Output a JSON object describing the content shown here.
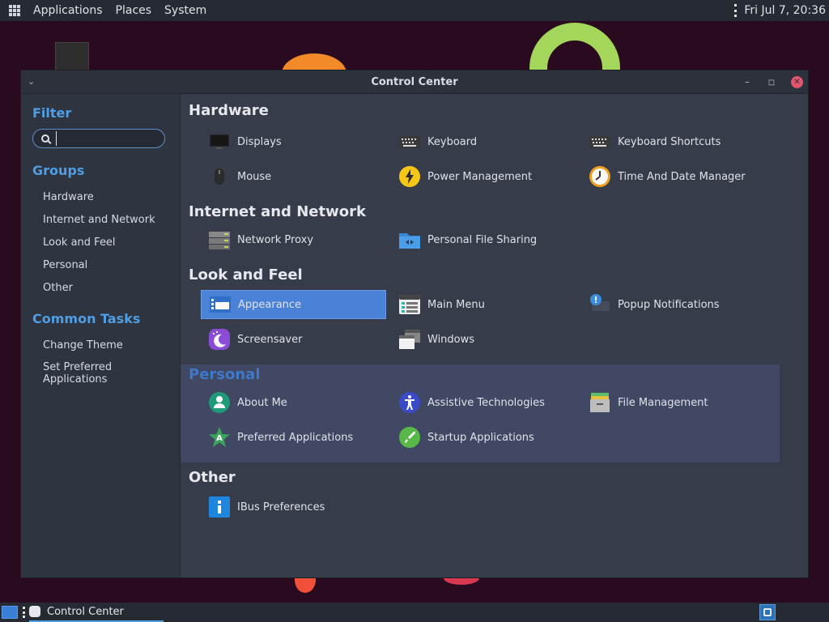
{
  "top_panel": {
    "menus": [
      "Applications",
      "Places",
      "System"
    ],
    "clock": "Fri Jul  7, 20:36"
  },
  "window": {
    "title": "Control Center"
  },
  "sidebar": {
    "filter_heading": "Filter",
    "search_value": "",
    "groups_heading": "Groups",
    "groups": [
      "Hardware",
      "Internet and Network",
      "Look and Feel",
      "Personal",
      "Other"
    ],
    "tasks_heading": "Common Tasks",
    "tasks": [
      "Change Theme",
      "Set Preferred Applications"
    ]
  },
  "sections": [
    {
      "title": "Hardware",
      "items": [
        "Displays",
        "Keyboard",
        "Keyboard Shortcuts",
        "Mouse",
        "Power Management",
        "Time And Date Manager"
      ]
    },
    {
      "title": "Internet and Network",
      "items": [
        "Network Proxy",
        "Personal File Sharing"
      ]
    },
    {
      "title": "Look and Feel",
      "items": [
        "Appearance",
        "Main Menu",
        "Popup Notifications",
        "Screensaver",
        "Windows"
      ]
    },
    {
      "title": "Personal",
      "items": [
        "About Me",
        "Assistive Technologies",
        "File Management",
        "Preferred Applications",
        "Startup Applications"
      ]
    },
    {
      "title": "Other",
      "items": [
        "IBus Preferences"
      ]
    }
  ],
  "taskbar": {
    "task": "Control Center"
  },
  "colors": {
    "accent": "#4f9ee3",
    "selection": "#4a82d8",
    "hover_section": "#414863"
  }
}
